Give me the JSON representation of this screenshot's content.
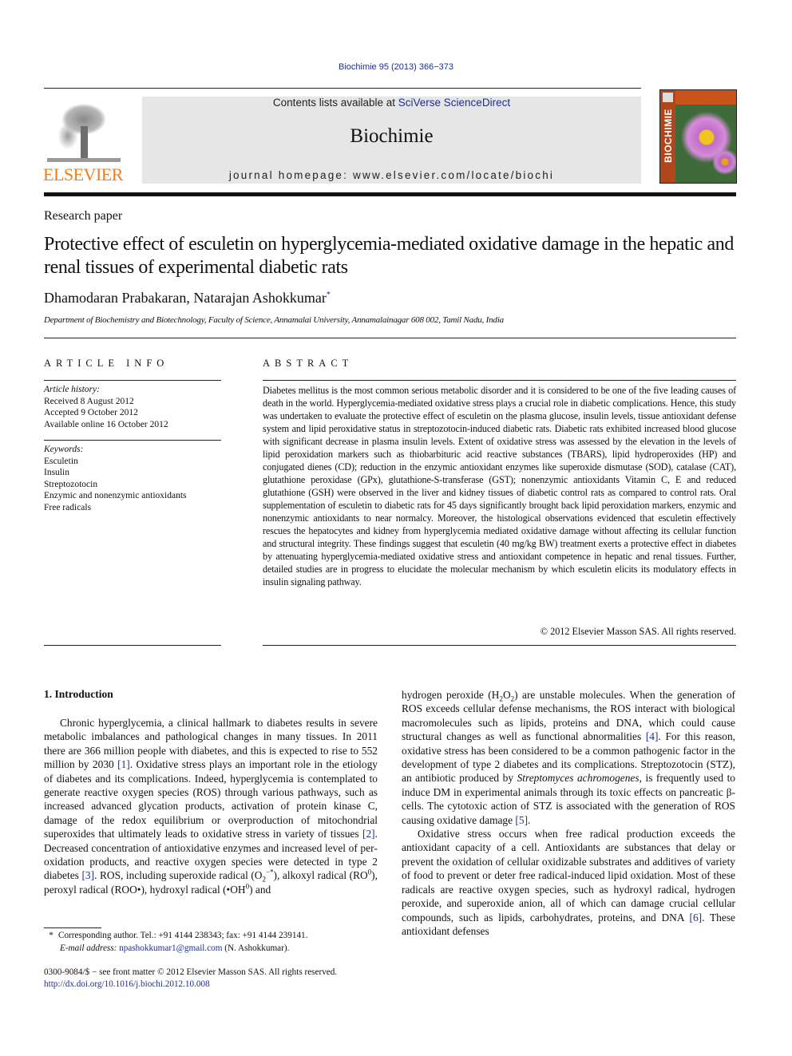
{
  "header": {
    "citation": "Biochimie 95 (2013) 366−373",
    "contents_prefix": "Contents lists available at ",
    "contents_link": "SciVerse ScienceDirect",
    "journal_name": "Biochimie",
    "homepage": "journal homepage: www.elsevier.com/locate/biochi",
    "publisher_logo_text": "ELSEVIER",
    "cover_spine_text": "BIOCHIMIE",
    "colors": {
      "link": "#1f2e8c",
      "elsevier_orange": "#f07d1b",
      "masthead_bg": "#e6e6e6",
      "cover_spine": "#b0461a"
    }
  },
  "article": {
    "type": "Research paper",
    "title": "Protective effect of esculetin on hyperglycemia-mediated oxidative damage in the hepatic and renal tissues of experimental diabetic rats",
    "authors": "Dhamodaran Prabakaran, Natarajan Ashokkumar",
    "author_mark": "*",
    "affiliation": "Department of Biochemistry and Biotechnology, Faculty of Science, Annamalai University, Annamalainagar 608 002, Tamil Nadu, India"
  },
  "article_info": {
    "heading": "ARTICLE INFO",
    "history_label": "Article history:",
    "history": [
      "Received 8 August 2012",
      "Accepted 9 October 2012",
      "Available online 16 October 2012"
    ],
    "keywords_label": "Keywords:",
    "keywords": [
      "Esculetin",
      "Insulin",
      "Streptozotocin",
      "Enzymic and nonenzymic antioxidants",
      "Free radicals"
    ]
  },
  "abstract": {
    "heading": "ABSTRACT",
    "text": "Diabetes mellitus is the most common serious metabolic disorder and it is considered to be one of the five leading causes of death in the world. Hyperglycemia-mediated oxidative stress plays a crucial role in diabetic complications. Hence, this study was undertaken to evaluate the protective effect of esculetin on the plasma glucose, insulin levels, tissue antioxidant defense system and lipid peroxidative status in streptozotocin-induced diabetic rats. Diabetic rats exhibited increased blood glucose with significant decrease in plasma insulin levels. Extent of oxidative stress was assessed by the elevation in the levels of lipid peroxidation markers such as thiobarbituric acid reactive substances (TBARS), lipid hydroperoxides (HP) and conjugated dienes (CD); reduction in the enzymic antioxidant enzymes like superoxide dis­mutase (SOD), catalase (CAT), glutathione peroxidase (GPx), glutathione-S-transferase (GST); nonen­zymic antioxidants Vitamin C, E and reduced glutathione (GSH) were observed in the liver and kidney tissues of diabetic control rats as compared to control rats. Oral supplementation of esculetin to diabetic rats for 45 days significantly brought back lipid peroxidation markers, enzymic and nonenzymic anti­oxidants to near normalcy. Moreover, the histological observations evidenced that esculetin effectively rescues the hepatocytes and kidney from hyperglycemia mediated oxidative damage without affecting its cellular function and structural integrity. These findings suggest that esculetin (40 mg/kg BW) treatment exerts a protective effect in diabetes by attenuating hyperglycemia-mediated oxidative stress and antioxidant competence in hepatic and renal tissues. Further, detailed studies are in progress to elucidate the molecular mechanism by which esculetin elicits its modulatory effects in insulin signaling pathway.",
    "copyright": "© 2012 Elsevier Masson SAS. All rights reserved."
  },
  "introduction": {
    "heading": "1.  Introduction",
    "left_p1": {
      "t1": "Chronic hyperglycemia, a clinical hallmark to diabetes results in severe metabolic imbalances and pathological changes in many tissues. In 2011 there are 366 million people with diabetes, and this is expected to rise to 552 million by 2030 ",
      "ref1": "[1]",
      "t2": ". Oxidative stress plays an important role in the etiology of diabetes and its complications. Indeed, hyperglycemia is contemplated to generate reactive oxygen species (ROS) through various pathways, such as increased advanced glycation products, activation of protein kinase C, damage of the redox equilibrium or overproduction of mitochondrial superoxides that ultimately leads to oxidative stress in variety of tissues ",
      "ref2": "[2]",
      "t3": ". Decreased concentration of antioxidative enzymes and increased level of per­oxidation products, and reactive oxygen species were detected in type 2 diabetes ",
      "ref3": "[3]",
      "t4": ". ROS, including superoxide radical (O",
      "sub_2": "2",
      "sup_minus": "−*",
      "t5": "), alkoxyl radical (RO",
      "sup_0a": "0",
      "t6": "), peroxyl radical (ROO•), hydroxyl radical (•OH",
      "sup_0b": "0",
      "t7": ") and"
    },
    "right_p1": {
      "t1": "hydrogen peroxide (H",
      "sub_a": "2",
      "t2": "O",
      "sub_b": "2",
      "t3": ") are unstable molecules. When the gener­ation of ROS exceeds cellular defense mechanisms, the ROS interact with biological macromolecules such as lipids, proteins and DNA, which could cause structural changes as well as functional abnor­malities ",
      "ref4": "[4]",
      "t4": ". For this reason, oxidative stress has been considered to be a common pathogenic factor in the development of type 2 diabetes and its complications. Streptozotocin (STZ), an antibiotic produced by ",
      "species": "Streptomyces achromogenes",
      "t5": ", is frequently used to induce DM in experimental animals through its toxic effects on pancreatic β-cells. The cytotoxic action of STZ is associated with the generation of ROS causing oxidative damage ",
      "ref5": "[5]",
      "t6": "."
    },
    "right_p2": {
      "t1": "Oxidative stress occurs when free radical production exceeds the antioxidant capacity of a cell. Antioxidants are substances that delay or prevent the oxidation of cellular oxidizable substrates and additives of variety of food to prevent or deter free radical-induced lipid oxidation. Most of these radicals are reactive oxygen species, such as hydroxyl radical, hydrogen peroxide, and superoxide anion, all of which can damage crucial cellular compounds, such as lipids, carbohydrates, proteins, and DNA ",
      "ref6": "[6]",
      "t2": ". These antioxidant defenses"
    }
  },
  "footnotes": {
    "star": "*",
    "corresponding": "Corresponding author. Tel.: +91 4144 238343; fax: +91 4144 239141.",
    "email_label": "E-mail address:",
    "email": "npashokkumar1@gmail.com",
    "email_suffix": " (N. Ashokkumar).",
    "front_matter": "0300-9084/$ − see front matter © 2012 Elsevier Masson SAS. All rights reserved.",
    "doi": "http://dx.doi.org/10.1016/j.biochi.2012.10.008"
  }
}
